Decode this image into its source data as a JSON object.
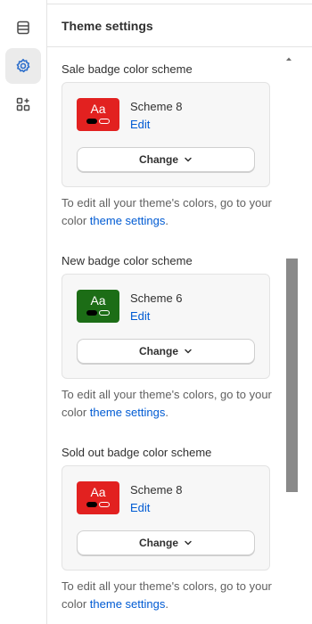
{
  "header": {
    "title": "Theme settings"
  },
  "rail": {
    "items": [
      {
        "icon": "sections-icon",
        "active": false
      },
      {
        "icon": "gear-icon",
        "active": true
      },
      {
        "icon": "apps-icon",
        "active": false
      }
    ]
  },
  "sections": [
    {
      "label": "Sale badge color scheme",
      "scheme_name": "Scheme 8",
      "edit_label": "Edit",
      "swatch_text": "Aa",
      "swatch_color": "#e22120",
      "change_label": "Change",
      "help_prefix": "To edit all your theme's colors, go to your color ",
      "help_link": "theme settings",
      "help_suffix": "."
    },
    {
      "label": "New badge color scheme",
      "scheme_name": "Scheme 6",
      "edit_label": "Edit",
      "swatch_text": "Aa",
      "swatch_color": "#1c6d16",
      "change_label": "Change",
      "help_prefix": "To edit all your theme's colors, go to your color ",
      "help_link": "theme settings",
      "help_suffix": "."
    },
    {
      "label": "Sold out badge color scheme",
      "scheme_name": "Scheme 8",
      "edit_label": "Edit",
      "swatch_text": "Aa",
      "swatch_color": "#e22120",
      "change_label": "Change",
      "help_prefix": "To edit all your theme's colors, go to your color ",
      "help_link": "theme settings",
      "help_suffix": "."
    }
  ],
  "colors": {
    "link": "#005bd3",
    "scrollbar_thumb": "#8a8a8a",
    "active_rail_bg": "#ebebeb"
  }
}
